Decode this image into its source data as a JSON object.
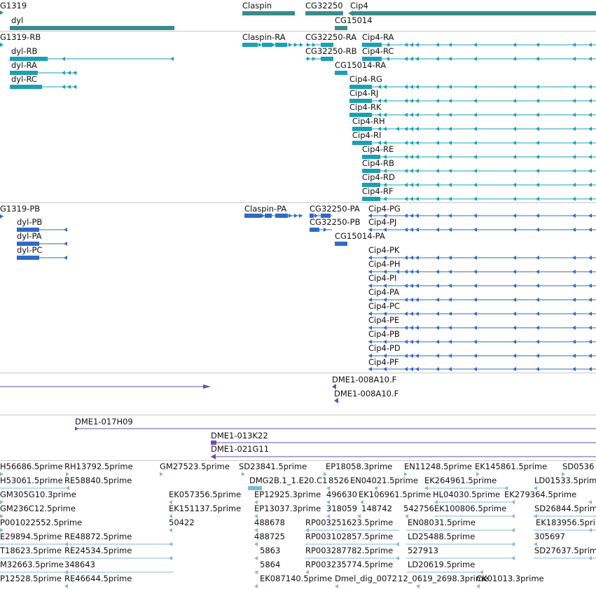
{
  "colors": {
    "gene": "#3a8b8b",
    "transcript": "#1aa0b4",
    "protein": "#2f6ac4",
    "clone": "#6a4db0",
    "est": "#86b8d8",
    "separator": "#c8c8c8"
  },
  "tracks": {
    "genes": {
      "labels": [
        "G1319",
        "dyl",
        "Claspin",
        "CG32250",
        "Cip4",
        "CG15014"
      ]
    },
    "transcripts": {
      "labels": [
        "G1319-RB",
        "dyl-RB",
        "dyl-RA",
        "dyl-RC",
        "Claspin-RA",
        "CG32250-RA",
        "Cip4-RA",
        "CG32250-RB",
        "Cip4-RC",
        "CG15014-RA",
        "Cip4-RG",
        "Cip4-RJ",
        "Cip4-RK",
        "Cip4-RH",
        "Cip4-RI",
        "Cip4-RE",
        "Cip4-RB",
        "Cip4-RD",
        "Cip4-RF"
      ]
    },
    "proteins": {
      "labels": [
        "G1319-PB",
        "dyl-PB",
        "dyl-PA",
        "dyl-PC",
        "Claspin-PA",
        "CG32250-PA",
        "Cip4-PG",
        "CG32250-PB",
        "Cip4-PJ",
        "CG15014-PA",
        "Cip4-PK",
        "Cip4-PH",
        "Cip4-PI",
        "Cip4-PA",
        "Cip4-PC",
        "Cip4-PE",
        "Cip4-PB",
        "Cip4-PD",
        "Cip4-PF"
      ]
    },
    "clones_a": {
      "labels": [
        "DME1-008A10.F",
        "DME1-008A10.F"
      ]
    },
    "clones_b": {
      "labels": [
        "DME1-017H09",
        "DME1-013K22",
        "DME1-021G11"
      ]
    },
    "ests": {
      "labels": [
        "H56686.5prime",
        "RH13792.5prime",
        "GM27523.5prime",
        "SD23841.5prime",
        "EP18058.3prime",
        "EN11248.5prime",
        "EK145861.5prime",
        "SD0536",
        "H53061.5prime",
        "RE58840.5prime",
        "DMG2B.1_1.E20.C1",
        "8526",
        "EN04021.5prime",
        "EK264961.5prime",
        "LD01533.5prime",
        "GM305G10.3prime",
        "EK057356.5prime",
        "EP12925.3prime",
        "496630",
        "EK106961.5prime",
        "HL04030.5prime",
        "EK279364.5prime",
        "GM236C12.5prime",
        "EK151137.5prime",
        "EP13037.3prime",
        "318059",
        "148742",
        "542756",
        "EK100806.5prime",
        "SD26844.5prime",
        "P001022552.5prime",
        "50422",
        "488678",
        "RP003251623.5prime",
        "EN08031.5prime",
        "EK183956.5prime",
        "E29894.5prime",
        "RE48872.5prime",
        "488725",
        "RP003102857.5prime",
        "LD25488.5prime",
        "305697",
        "T18623.5prime",
        "RE24534.5prime",
        "5863",
        "RP003287782.5prime",
        "527913",
        "SD27637.5prime",
        "M32663.5prime",
        "348643",
        "5864",
        "RP003235774.5prime",
        "LD20619.5prime",
        "P12528.5prime",
        "RE46644.5prime",
        "EK087140.5prime",
        "Dmel_dig_0072",
        "12_0619_2698.3prime",
        "CK01013.3prime"
      ]
    }
  }
}
